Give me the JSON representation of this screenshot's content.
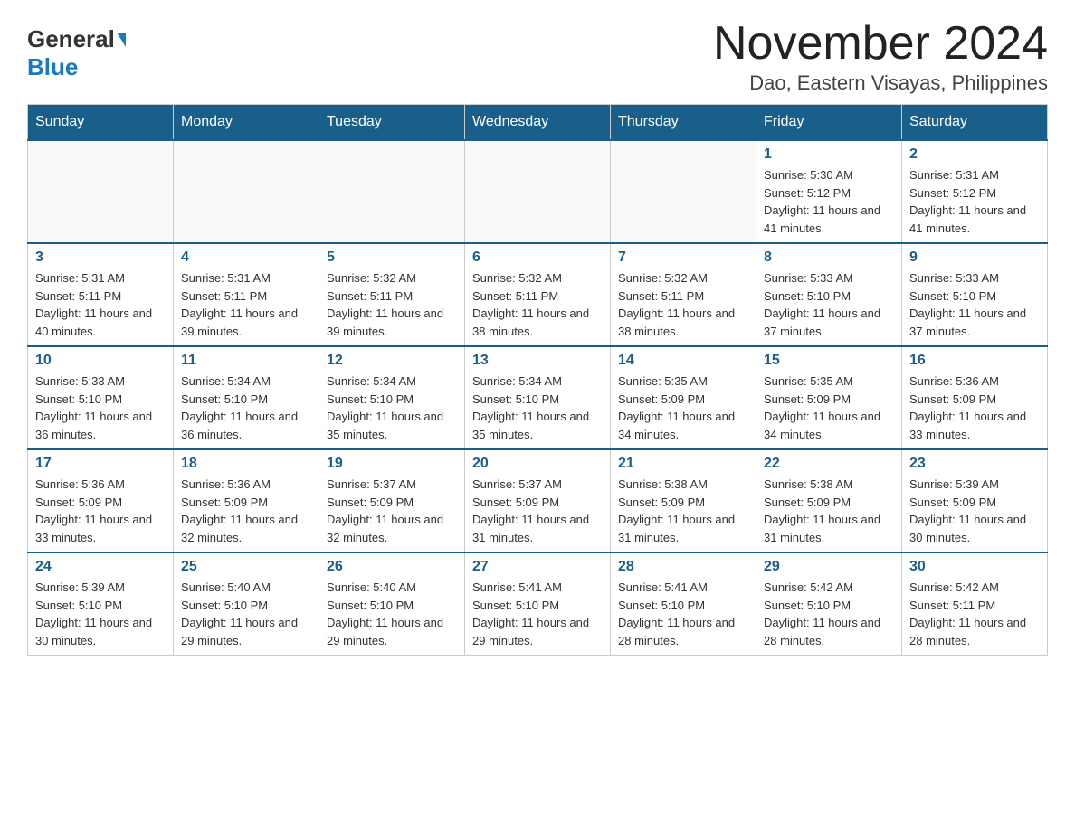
{
  "logo": {
    "general": "General",
    "blue": "Blue"
  },
  "title": "November 2024",
  "subtitle": "Dao, Eastern Visayas, Philippines",
  "days_of_week": [
    "Sunday",
    "Monday",
    "Tuesday",
    "Wednesday",
    "Thursday",
    "Friday",
    "Saturday"
  ],
  "weeks": [
    [
      {
        "day": "",
        "info": ""
      },
      {
        "day": "",
        "info": ""
      },
      {
        "day": "",
        "info": ""
      },
      {
        "day": "",
        "info": ""
      },
      {
        "day": "",
        "info": ""
      },
      {
        "day": "1",
        "info": "Sunrise: 5:30 AM\nSunset: 5:12 PM\nDaylight: 11 hours and 41 minutes."
      },
      {
        "day": "2",
        "info": "Sunrise: 5:31 AM\nSunset: 5:12 PM\nDaylight: 11 hours and 41 minutes."
      }
    ],
    [
      {
        "day": "3",
        "info": "Sunrise: 5:31 AM\nSunset: 5:11 PM\nDaylight: 11 hours and 40 minutes."
      },
      {
        "day": "4",
        "info": "Sunrise: 5:31 AM\nSunset: 5:11 PM\nDaylight: 11 hours and 39 minutes."
      },
      {
        "day": "5",
        "info": "Sunrise: 5:32 AM\nSunset: 5:11 PM\nDaylight: 11 hours and 39 minutes."
      },
      {
        "day": "6",
        "info": "Sunrise: 5:32 AM\nSunset: 5:11 PM\nDaylight: 11 hours and 38 minutes."
      },
      {
        "day": "7",
        "info": "Sunrise: 5:32 AM\nSunset: 5:11 PM\nDaylight: 11 hours and 38 minutes."
      },
      {
        "day": "8",
        "info": "Sunrise: 5:33 AM\nSunset: 5:10 PM\nDaylight: 11 hours and 37 minutes."
      },
      {
        "day": "9",
        "info": "Sunrise: 5:33 AM\nSunset: 5:10 PM\nDaylight: 11 hours and 37 minutes."
      }
    ],
    [
      {
        "day": "10",
        "info": "Sunrise: 5:33 AM\nSunset: 5:10 PM\nDaylight: 11 hours and 36 minutes."
      },
      {
        "day": "11",
        "info": "Sunrise: 5:34 AM\nSunset: 5:10 PM\nDaylight: 11 hours and 36 minutes."
      },
      {
        "day": "12",
        "info": "Sunrise: 5:34 AM\nSunset: 5:10 PM\nDaylight: 11 hours and 35 minutes."
      },
      {
        "day": "13",
        "info": "Sunrise: 5:34 AM\nSunset: 5:10 PM\nDaylight: 11 hours and 35 minutes."
      },
      {
        "day": "14",
        "info": "Sunrise: 5:35 AM\nSunset: 5:09 PM\nDaylight: 11 hours and 34 minutes."
      },
      {
        "day": "15",
        "info": "Sunrise: 5:35 AM\nSunset: 5:09 PM\nDaylight: 11 hours and 34 minutes."
      },
      {
        "day": "16",
        "info": "Sunrise: 5:36 AM\nSunset: 5:09 PM\nDaylight: 11 hours and 33 minutes."
      }
    ],
    [
      {
        "day": "17",
        "info": "Sunrise: 5:36 AM\nSunset: 5:09 PM\nDaylight: 11 hours and 33 minutes."
      },
      {
        "day": "18",
        "info": "Sunrise: 5:36 AM\nSunset: 5:09 PM\nDaylight: 11 hours and 32 minutes."
      },
      {
        "day": "19",
        "info": "Sunrise: 5:37 AM\nSunset: 5:09 PM\nDaylight: 11 hours and 32 minutes."
      },
      {
        "day": "20",
        "info": "Sunrise: 5:37 AM\nSunset: 5:09 PM\nDaylight: 11 hours and 31 minutes."
      },
      {
        "day": "21",
        "info": "Sunrise: 5:38 AM\nSunset: 5:09 PM\nDaylight: 11 hours and 31 minutes."
      },
      {
        "day": "22",
        "info": "Sunrise: 5:38 AM\nSunset: 5:09 PM\nDaylight: 11 hours and 31 minutes."
      },
      {
        "day": "23",
        "info": "Sunrise: 5:39 AM\nSunset: 5:09 PM\nDaylight: 11 hours and 30 minutes."
      }
    ],
    [
      {
        "day": "24",
        "info": "Sunrise: 5:39 AM\nSunset: 5:10 PM\nDaylight: 11 hours and 30 minutes."
      },
      {
        "day": "25",
        "info": "Sunrise: 5:40 AM\nSunset: 5:10 PM\nDaylight: 11 hours and 29 minutes."
      },
      {
        "day": "26",
        "info": "Sunrise: 5:40 AM\nSunset: 5:10 PM\nDaylight: 11 hours and 29 minutes."
      },
      {
        "day": "27",
        "info": "Sunrise: 5:41 AM\nSunset: 5:10 PM\nDaylight: 11 hours and 29 minutes."
      },
      {
        "day": "28",
        "info": "Sunrise: 5:41 AM\nSunset: 5:10 PM\nDaylight: 11 hours and 28 minutes."
      },
      {
        "day": "29",
        "info": "Sunrise: 5:42 AM\nSunset: 5:10 PM\nDaylight: 11 hours and 28 minutes."
      },
      {
        "day": "30",
        "info": "Sunrise: 5:42 AM\nSunset: 5:11 PM\nDaylight: 11 hours and 28 minutes."
      }
    ]
  ]
}
